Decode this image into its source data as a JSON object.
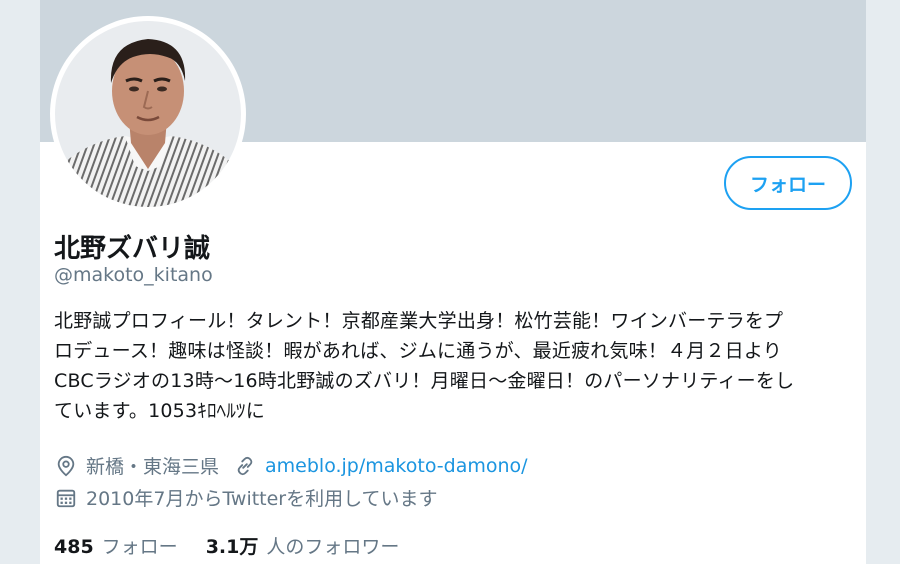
{
  "profile": {
    "name": "北野ズバリ誠",
    "handle": "@makoto_kitano",
    "follow_button": "フォロー",
    "bio_lines": [
      "北野誠プロフィール！タレント！京都産業大学出身！松竹芸能！ワインバーテラをプ",
      "ロデュース！趣味は怪談！暇があれば、ジムに通うが、最近疲れ気味！４月２日より",
      "CBCラジオの13時〜16時北野誠のズバリ！月曜日〜金曜日！のパーソナリティーをし",
      "ています。1053ｷﾛﾍﾙﾂに"
    ],
    "location": "新橋・東海三県",
    "website": "ameblo.jp/makoto-damono/",
    "joined": "2010年7月からTwitterを利用しています",
    "following_count": "485",
    "following_label": "フォロー",
    "followers_count": "3.1万",
    "followers_label": "人のフォロワー"
  },
  "icons": {
    "location": "location-pin-icon",
    "link": "link-icon",
    "calendar": "calendar-icon"
  },
  "colors": {
    "accent": "#1da1f2",
    "link": "#1b95e0",
    "muted": "#657786",
    "banner": "#ccd6dd",
    "page_bg": "#e6ecf0"
  }
}
